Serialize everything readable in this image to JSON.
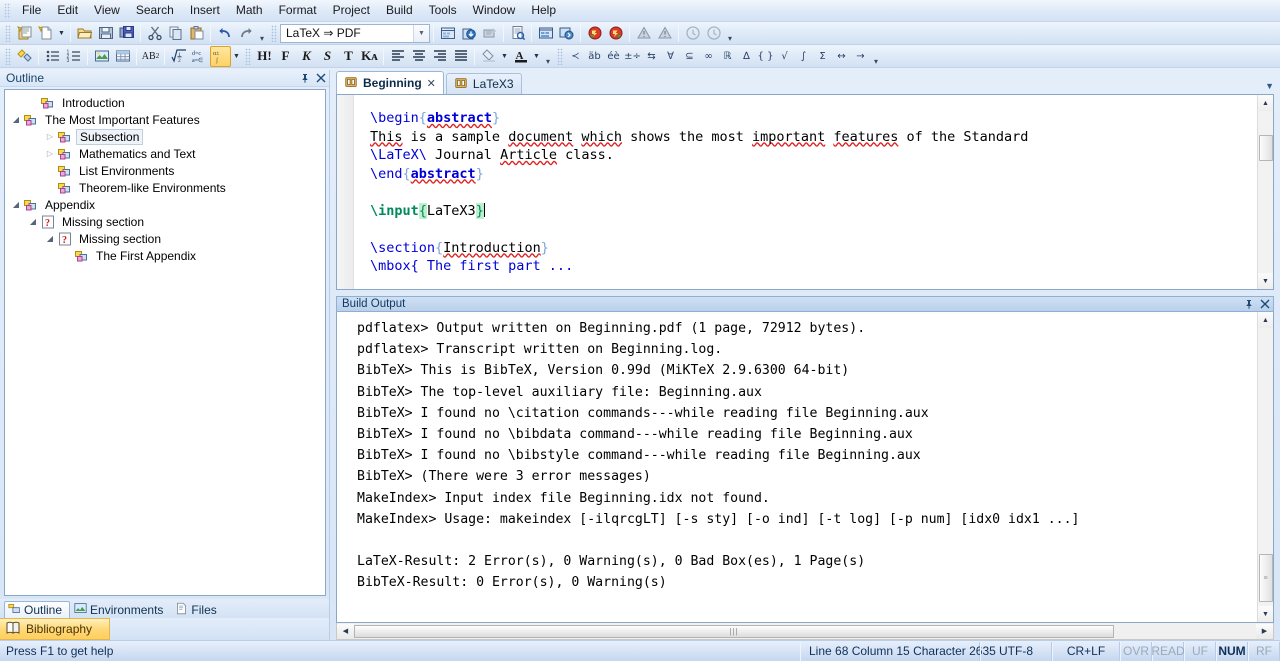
{
  "menubar": {
    "items": [
      "File",
      "Edit",
      "View",
      "Search",
      "Insert",
      "Math",
      "Format",
      "Project",
      "Build",
      "Tools",
      "Window",
      "Help"
    ]
  },
  "toolbar_standard": {
    "buttons": [
      {
        "name": "new-project-icon",
        "glyph": "new-project"
      },
      {
        "name": "new-file-icon",
        "glyph": "new-file"
      },
      {
        "name": "new-file-dropdown-icon",
        "glyph": "caret"
      },
      {
        "name": "open-icon",
        "glyph": "folder"
      },
      {
        "name": "save-icon",
        "glyph": "floppy"
      },
      {
        "name": "save-all-icon",
        "glyph": "save-all"
      },
      {
        "name": "cut-icon",
        "glyph": "scissors"
      },
      {
        "name": "copy-icon",
        "glyph": "copy"
      },
      {
        "name": "paste-icon",
        "glyph": "paste"
      },
      {
        "name": "undo-icon",
        "glyph": "undo"
      },
      {
        "name": "redo-icon",
        "glyph": "redo"
      }
    ],
    "profile_combo_value": "LaTeX ⇒ PDF",
    "build_buttons": [
      {
        "name": "build-icon",
        "glyph": "build"
      },
      {
        "name": "build-and-view-icon",
        "glyph": "build-view"
      },
      {
        "name": "stop-build-icon",
        "glyph": "stop-build"
      },
      {
        "name": "view-pdf-icon",
        "glyph": "view-doc"
      },
      {
        "name": "forward-search-icon",
        "glyph": "fwd-search"
      },
      {
        "name": "inverse-search-icon",
        "glyph": "inv-search"
      },
      {
        "name": "previous-error-icon",
        "glyph": "prev-error"
      },
      {
        "name": "next-error-icon",
        "glyph": "next-error"
      },
      {
        "name": "previous-warning-icon",
        "glyph": "prev-warning"
      },
      {
        "name": "next-warning-icon",
        "glyph": "next-warning"
      },
      {
        "name": "previous-bad-box-icon",
        "glyph": "prev-badbox"
      },
      {
        "name": "next-bad-box-icon",
        "glyph": "next-badbox"
      }
    ]
  },
  "toolbar_insert": {
    "buttons": [
      {
        "name": "insert-snippet-icon",
        "glyph": "snippet"
      },
      {
        "name": "itemize-icon",
        "glyph": "bullets"
      },
      {
        "name": "enumerate-icon",
        "glyph": "numbers"
      },
      {
        "name": "insert-graphic-icon",
        "glyph": "image"
      },
      {
        "name": "insert-table-icon",
        "glyph": "table"
      },
      {
        "name": "superscript-icon",
        "glyph": "ab2"
      },
      {
        "name": "insert-math-icon",
        "glyph": "sqrt"
      },
      {
        "name": "insert-equation-icon",
        "glyph": "eqn"
      },
      {
        "name": "insert-symbol-icon",
        "glyph": "symbol"
      }
    ],
    "format_buttons": [
      {
        "name": "heading-button",
        "label": "H!",
        "italic": false
      },
      {
        "name": "bold-button",
        "label": "F",
        "italic": false
      },
      {
        "name": "italic-button",
        "label": "K",
        "italic": true
      },
      {
        "name": "slanted-button",
        "label": "S",
        "italic": true
      },
      {
        "name": "typewriter-button",
        "label": "T",
        "italic": false
      },
      {
        "name": "smallcaps-button",
        "label": "Kᴀ",
        "italic": false
      }
    ],
    "align_buttons": [
      {
        "name": "align-left-icon",
        "glyph": "align-left"
      },
      {
        "name": "align-center-icon",
        "glyph": "align-center"
      },
      {
        "name": "align-right-icon",
        "glyph": "align-right"
      },
      {
        "name": "align-justify-icon",
        "glyph": "align-justify"
      }
    ],
    "color_buttons": [
      {
        "name": "highlight-color-icon",
        "glyph": "highlight"
      },
      {
        "name": "font-color-icon",
        "glyph": "font-color"
      }
    ],
    "math_symbols": [
      "≺",
      "äb",
      "éè",
      "±÷",
      "⇆",
      "∀",
      "⊆",
      "∞",
      "ℝ",
      "∆",
      "{ }",
      "√",
      "∫",
      "Σ",
      "↔",
      "→"
    ]
  },
  "outline": {
    "title": "Outline",
    "pin_icon": "pin-icon",
    "close_icon": "close-icon",
    "items": [
      {
        "label": "Introduction",
        "depth": 1,
        "twisty": "none",
        "icon": "section-icon",
        "selected": false
      },
      {
        "label": "The Most Important Features",
        "depth": 0,
        "twisty": "expanded",
        "icon": "section-icon",
        "selected": false
      },
      {
        "label": "Subsection",
        "depth": 2,
        "twisty": "collapsed",
        "icon": "section-icon",
        "selected": true
      },
      {
        "label": "Mathematics and Text",
        "depth": 2,
        "twisty": "collapsed",
        "icon": "section-icon",
        "selected": false
      },
      {
        "label": "List Environments",
        "depth": 2,
        "twisty": "none",
        "icon": "section-icon",
        "selected": false
      },
      {
        "label": "Theorem-like Environments",
        "depth": 2,
        "twisty": "none",
        "icon": "section-icon",
        "selected": false
      },
      {
        "label": "Appendix",
        "depth": 0,
        "twisty": "expanded",
        "icon": "section-icon",
        "selected": false
      },
      {
        "label": "Missing section",
        "depth": 1,
        "twisty": "expanded",
        "icon": "missing-icon",
        "selected": false
      },
      {
        "label": "Missing section",
        "depth": 2,
        "twisty": "expanded",
        "icon": "missing-icon",
        "selected": false
      },
      {
        "label": "The First Appendix",
        "depth": 3,
        "twisty": "none",
        "icon": "section-icon",
        "selected": false
      }
    ],
    "bottom_tabs": [
      {
        "label": "Outline",
        "icon": "outline-icon",
        "active": true
      },
      {
        "label": "Environments",
        "icon": "environments-icon",
        "active": false
      },
      {
        "label": "Files",
        "icon": "files-icon",
        "active": false
      }
    ],
    "bibliography_bar": {
      "label": "Bibliography",
      "icon": "book-icon"
    }
  },
  "editor": {
    "tabs": [
      {
        "label": "Beginning",
        "active": true,
        "closable": true,
        "icon": "document-icon"
      },
      {
        "label": "LaTeX3",
        "active": false,
        "closable": false,
        "icon": "document-icon"
      }
    ],
    "lines": [
      {
        "segments": [
          {
            "t": "\\begin",
            "c": "kw"
          },
          {
            "t": "{",
            "c": "brace"
          },
          {
            "t": "abstract",
            "c": "spell-kw"
          },
          {
            "t": "}",
            "c": "brace"
          }
        ]
      },
      {
        "segments": [
          {
            "t": "This",
            "c": "spell"
          },
          {
            "t": " is a sample ",
            "c": ""
          },
          {
            "t": "document",
            "c": "spell"
          },
          {
            "t": " ",
            "c": ""
          },
          {
            "t": "which",
            "c": "spell"
          },
          {
            "t": " shows the most ",
            "c": ""
          },
          {
            "t": "important",
            "c": "spell"
          },
          {
            "t": " ",
            "c": ""
          },
          {
            "t": "features",
            "c": "spell"
          },
          {
            "t": " of the Standard",
            "c": ""
          }
        ]
      },
      {
        "segments": [
          {
            "t": "\\LaTeX\\",
            "c": "kw"
          },
          {
            "t": " Journal ",
            "c": ""
          },
          {
            "t": "Article",
            "c": "spell"
          },
          {
            "t": " class.",
            "c": ""
          }
        ]
      },
      {
        "segments": [
          {
            "t": "\\end",
            "c": "kw"
          },
          {
            "t": "{",
            "c": "brace"
          },
          {
            "t": "abstract",
            "c": "spell-kw"
          },
          {
            "t": "}",
            "c": "brace"
          }
        ]
      },
      {
        "segments": []
      },
      {
        "segments": [
          {
            "t": "\\input",
            "c": "kwg"
          },
          {
            "t": "{",
            "c": "braceg"
          },
          {
            "t": "LaTeX3",
            "c": ""
          },
          {
            "t": "}",
            "c": "braceg"
          },
          {
            "t": "|",
            "c": "caret"
          }
        ]
      },
      {
        "segments": []
      },
      {
        "segments": [
          {
            "t": "\\section",
            "c": "kw"
          },
          {
            "t": "{",
            "c": "brace"
          },
          {
            "t": "Introduction",
            "c": "spell"
          },
          {
            "t": "}",
            "c": "brace"
          }
        ]
      },
      {
        "segments": [
          {
            "t": "\\mbox{ The first part ...",
            "c": "clip"
          }
        ]
      }
    ]
  },
  "build_output": {
    "title": "Build Output",
    "pin_icon": "pin-icon",
    "close_icon": "close-icon",
    "lines": [
      "pdflatex> Output written on Beginning.pdf (1 page, 72912 bytes).",
      "pdflatex> Transcript written on Beginning.log.",
      "BibTeX> This is BibTeX, Version 0.99d (MiKTeX 2.9.6300 64-bit)",
      "BibTeX> The top-level auxiliary file: Beginning.aux",
      "BibTeX> I found no \\citation commands---while reading file Beginning.aux",
      "BibTeX> I found no \\bibdata command---while reading file Beginning.aux",
      "BibTeX> I found no \\bibstyle command---while reading file Beginning.aux",
      "BibTeX> (There were 3 error messages)",
      "MakeIndex> Input index file Beginning.idx not found.",
      "MakeIndex> Usage: makeindex [-ilqrcgLT] [-s sty] [-o ind] [-t log] [-p num] [idx0 idx1 ...]",
      "",
      "LaTeX-Result: 2 Error(s), 0 Warning(s), 0 Bad Box(es), 1 Page(s)",
      "BibTeX-Result: 0 Error(s), 0 Warning(s)"
    ]
  },
  "statusbar": {
    "hint": "Press F1 to get help",
    "position": "Line 68 Column 15 Character 2635",
    "encoding": "UTF-8",
    "line_ending": "CR+LF",
    "flags": [
      {
        "label": "OVR",
        "on": false
      },
      {
        "label": "READ",
        "on": false
      },
      {
        "label": "UF",
        "on": false
      },
      {
        "label": "NUM",
        "on": true
      },
      {
        "label": "RF",
        "on": false
      }
    ]
  },
  "colors": {
    "accent": "#1c4a77",
    "keyword": "#0000d8",
    "keyword_green": "#008a5c",
    "brace": "#7da6d8",
    "highlight_green": "#bdf0cf",
    "spell_underline": "#e02020",
    "bibliography_bar": "#ffd978"
  }
}
